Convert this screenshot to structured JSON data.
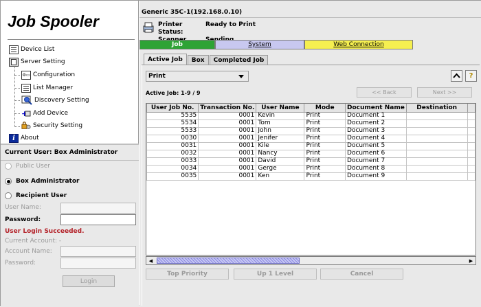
{
  "app": {
    "title": "Job Spooler"
  },
  "tree": {
    "device_list": "Device List",
    "server_setting": "Server Setting",
    "configuration": "Configuration",
    "list_manager": "List Manager",
    "discovery_setting": "Discovery Setting",
    "add_device": "Add Device",
    "security_setting": "Security Setting",
    "about": "About"
  },
  "login": {
    "current_user": "Current User: Box Administrator",
    "public_user": "Public User",
    "box_admin": "Box Administrator",
    "recipient_user": "Recipient User",
    "user_name_label": "User Name:",
    "password_label": "Password:",
    "success_msg": "User Login Succeeded.",
    "current_account": "Current Account: -",
    "account_name_label": "Account Name:",
    "account_password_label": "Password:",
    "login_button": "Login",
    "selected": "Box Administrator"
  },
  "device": {
    "name": "Generic 35C-1(192.168.0.10)",
    "printer_status_label": "Printer Status:",
    "printer_status_value": "Ready to Print",
    "scanner_status_label": "Scanner Status:",
    "scanner_status_value": "Sending"
  },
  "nav": {
    "job": "Job",
    "system": "System",
    "web": "Web Connection",
    "colors": {
      "job": "#2ea335",
      "system": "#c8c8f0",
      "web": "#f5ef50"
    }
  },
  "tabs": [
    "Active Job",
    "Box",
    "Completed Job"
  ],
  "active_tab": "Active Job",
  "job": {
    "filter_value": "Print",
    "count": "Active Job: 1-9 / 9",
    "back": "<< Back",
    "next": "Next >>",
    "help_icon": "?",
    "columns": [
      "User Job No.",
      "Transaction No.",
      "User Name",
      "Mode",
      "Document Name",
      "Destination"
    ],
    "rows": [
      [
        "5535",
        "0001",
        "Kevin",
        "Print",
        "Document 1",
        ""
      ],
      [
        "5534",
        "0001",
        "Tom",
        "Print",
        "Document 2",
        ""
      ],
      [
        "5533",
        "0001",
        "John",
        "Print",
        "Document 3",
        ""
      ],
      [
        "0030",
        "0001",
        "Jenifer",
        "Print",
        "Document 4",
        ""
      ],
      [
        "0031",
        "0001",
        "Kile",
        "Print",
        "Document 5",
        ""
      ],
      [
        "0032",
        "0001",
        "Nancy",
        "Print",
        "Document 6",
        ""
      ],
      [
        "0033",
        "0001",
        "David",
        "Print",
        "Document 7",
        ""
      ],
      [
        "0034",
        "0001",
        "Gerge",
        "Print",
        "Document 8",
        ""
      ],
      [
        "0035",
        "0001",
        "Ken",
        "Print",
        "Document 9",
        ""
      ]
    ],
    "top_priority": "Top Priority",
    "up_one_level": "Up 1 Level",
    "cancel": "Cancel"
  }
}
